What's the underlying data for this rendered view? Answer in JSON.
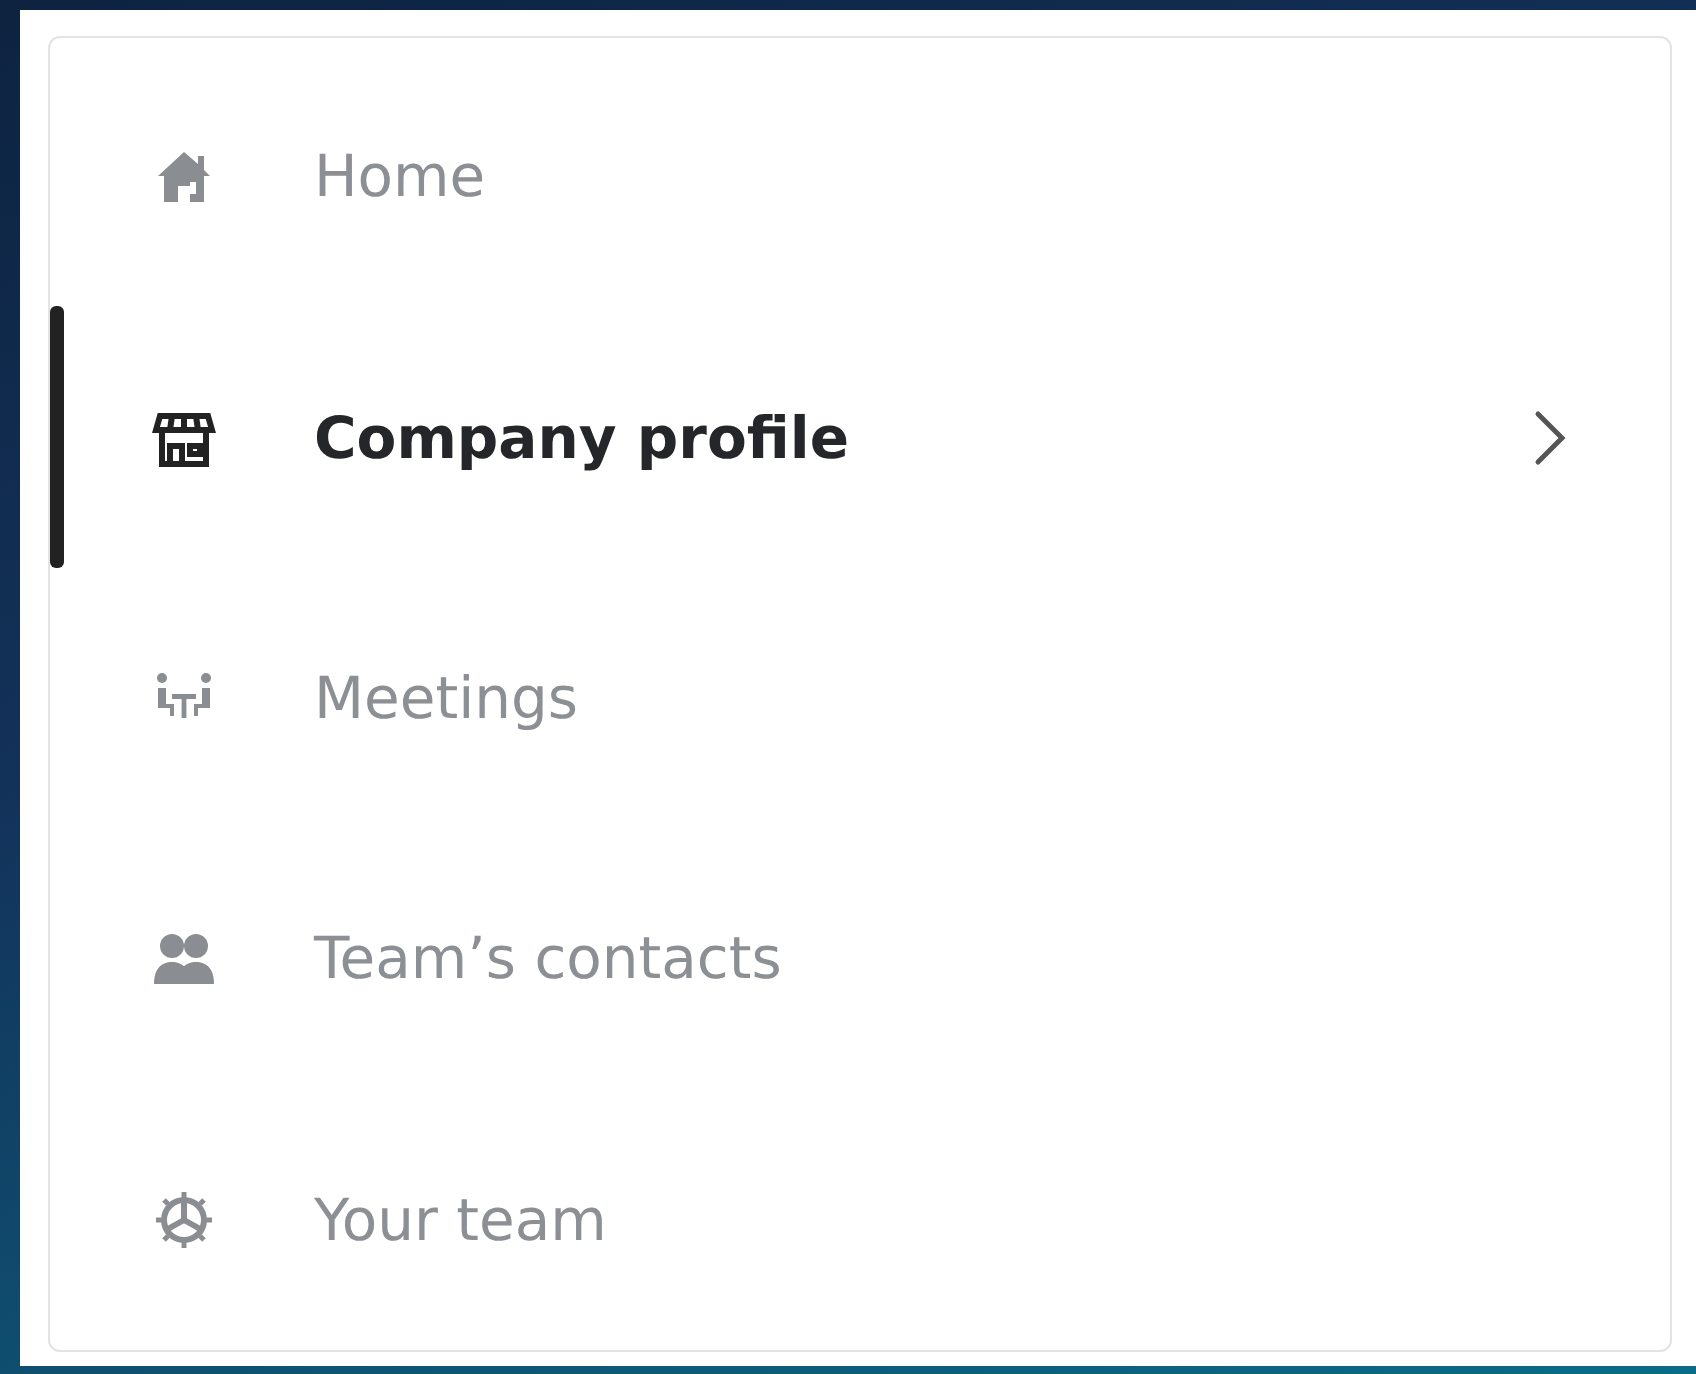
{
  "sidebar": {
    "items": [
      {
        "label": "Home",
        "kind": "home",
        "selected": false
      },
      {
        "label": "Company profile",
        "kind": "store",
        "selected": true
      },
      {
        "label": "Meetings",
        "kind": "meeting",
        "selected": false
      },
      {
        "label": "Team’s contacts",
        "kind": "contacts",
        "selected": false
      },
      {
        "label": "Your team",
        "kind": "team",
        "selected": false
      }
    ]
  }
}
